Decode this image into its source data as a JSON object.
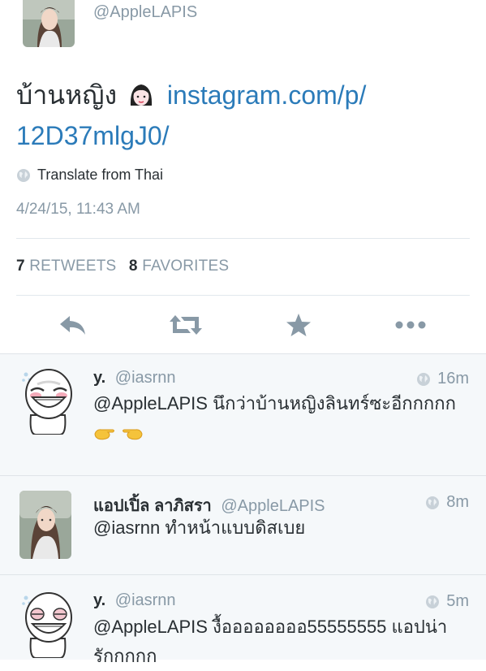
{
  "main_tweet": {
    "handle": "@AppleLAPIS",
    "text_thai": "บ้านหญิง",
    "link_line1": "instagram.com/p/",
    "link_line2": "12D37mlgJ0/",
    "translate_label": "Translate from Thai",
    "timestamp": "4/24/15, 11:43 AM",
    "retweets_count": "7",
    "retweets_label": "RETWEETS",
    "favorites_count": "8",
    "favorites_label": "FAVORITES"
  },
  "icons": {
    "reply": "reply-arrow-icon",
    "retweet": "retweet-icon",
    "favorite": "star-icon",
    "more": "more-dots-icon",
    "globe": "globe-icon"
  },
  "replies": [
    {
      "name": "y.",
      "handle": "@iasrnn",
      "time": "16m",
      "text": "@AppleLAPIS นึกว่าบ้านหญิงลินทร์ซะอีกกกกก",
      "emoji": "👉👈"
    },
    {
      "name": "แอปเปิ้ล ลาภิสรา",
      "handle": "@AppleLAPIS",
      "time": "8m",
      "text": "@iasrnn ทำหน้าแบบดิสเบย"
    },
    {
      "name": "y.",
      "handle": "@iasrnn",
      "time": "5m",
      "text_line1": "@AppleLAPIS งื้ออออออออ55555555 แอปน่า",
      "text_line2": "รักกกกก"
    }
  ],
  "colors": {
    "link": "#2b7bb9",
    "muted": "#8899a6",
    "text": "#292f33",
    "reply_bg": "#f5f8fa",
    "emoji_hand": "#f5c33b"
  }
}
